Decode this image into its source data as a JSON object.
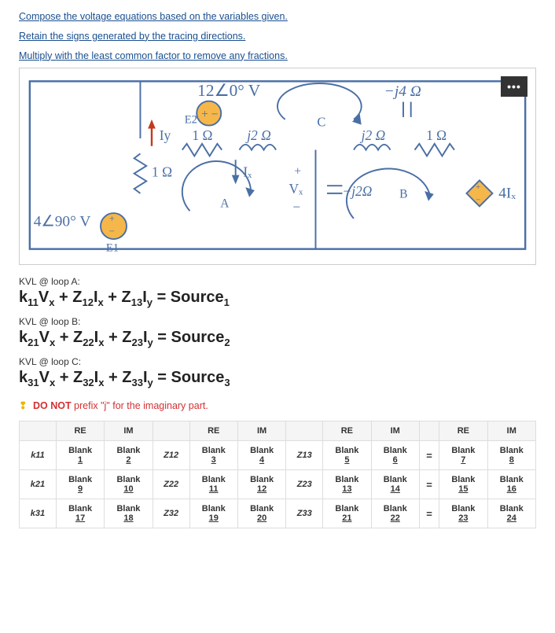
{
  "instructions": {
    "line1": "Compose the voltage equations based on the variables given.",
    "line2": "Retain the signs generated by the tracing directions.",
    "line3": "Multiply with the least common factor to remove any fractions."
  },
  "circuit": {
    "top_source": "12∠0° V",
    "top_cap": "−j4 Ω",
    "e2": "E2",
    "iy": "Iy",
    "r_top1": "1 Ω",
    "l_top1": "j2 Ω",
    "l_top2": "j2 Ω",
    "r_top2": "1 Ω",
    "r_left": "1 Ω",
    "ix": "Iₓ",
    "vx_plus": "+",
    "vx": "Vₓ",
    "vx_minus": "−",
    "cap_mid": "−j2Ω",
    "dep_src": "4Iₓ",
    "left_source": "4∠90° V",
    "e1": "E1",
    "node_c": "C",
    "loop_a": "A",
    "loop_b": "B",
    "more": "•••"
  },
  "kvl": {
    "a_label": "KVL @ loop A:",
    "a_eq": "k₁₁Vₓ + Z₁₂Iₓ + Z₁₃Iy = Source₁",
    "b_label": "KVL @ loop B:",
    "b_eq": "k₂₁Vₓ + Z₂₂Iₓ + Z₂₃Iy = Source₂",
    "c_label": "KVL @ loop C:",
    "c_eq": "k₃₁Vₓ + Z₃₂Iₓ + Z₃₃Iy = Source₃"
  },
  "donot": {
    "bang": "❢",
    "bold": "DO NOT",
    "rest": " prefix \"j\" for the imaginary part."
  },
  "table": {
    "headers": {
      "re": "RE",
      "im": "IM",
      "eq": "="
    },
    "rows": [
      {
        "name": "k11",
        "cells": [
          "Blank 1",
          "Blank 2",
          "Z12",
          "Blank 3",
          "Blank 4",
          "Z13",
          "Blank 5",
          "Blank 6",
          "=",
          "Blank 7",
          "Blank 8"
        ]
      },
      {
        "name": "k21",
        "cells": [
          "Blank 9",
          "Blank 10",
          "Z22",
          "Blank 11",
          "Blank 12",
          "Z23",
          "Blank 13",
          "Blank 14",
          "=",
          "Blank 15",
          "Blank 16"
        ]
      },
      {
        "name": "k31",
        "cells": [
          "Blank 17",
          "Blank 18",
          "Z32",
          "Blank 19",
          "Blank 20",
          "Z33",
          "Blank 21",
          "Blank 22",
          "=",
          "Blank 23",
          "Blank 24"
        ]
      }
    ]
  }
}
